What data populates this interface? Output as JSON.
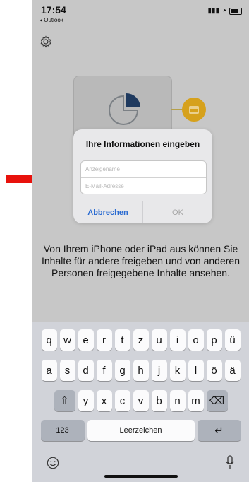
{
  "status_bar": {
    "time": "17:54",
    "back_label": "◂ Outlook"
  },
  "dialog": {
    "title": "Ihre Informationen eingeben",
    "display_name_placeholder": "Anzeigename",
    "email_placeholder": "E-Mail-Adresse",
    "cancel_label": "Abbrechen",
    "ok_label": "OK"
  },
  "body_text": "Von Ihrem iPhone oder iPad aus können Sie Inhalte für andere freigeben und von anderen Personen freigegebene Inhalte ansehen.",
  "keyboard": {
    "row1": [
      "q",
      "w",
      "e",
      "r",
      "t",
      "z",
      "u",
      "i",
      "o",
      "p",
      "ü"
    ],
    "row2": [
      "a",
      "s",
      "d",
      "f",
      "g",
      "h",
      "j",
      "k",
      "l",
      "ö",
      "ä"
    ],
    "row3": [
      "y",
      "x",
      "c",
      "v",
      "b",
      "n",
      "m"
    ],
    "numbers_label": "123",
    "space_label": "Leerzeichen",
    "return_label": "↵",
    "shift_label": "⇧",
    "delete_label": "⌫"
  },
  "colors": {
    "arrow": "#e8120c",
    "accent": "#2a6bd1",
    "folder": "#d6a11c"
  },
  "icons": [
    "gear-icon",
    "pie-chart-icon",
    "folder-icon",
    "emoji-icon",
    "microphone-icon",
    "shift-icon",
    "delete-icon",
    "return-icon"
  ]
}
